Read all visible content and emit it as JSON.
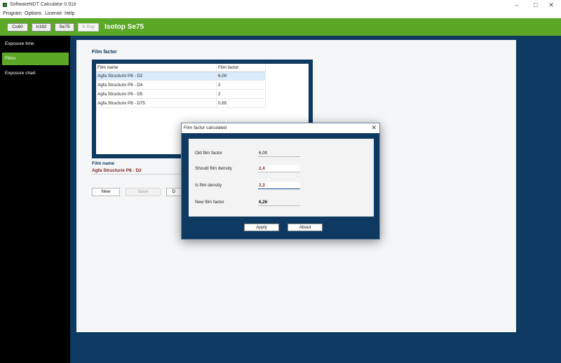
{
  "window": {
    "title": "SoftwareNDT Calculator 0.91e",
    "minimize_glyph": "–",
    "maximize_glyph": "□",
    "close_glyph": "✕"
  },
  "menu": [
    "Program",
    "Options",
    "License",
    "Help"
  ],
  "toolbar": {
    "isotopes": [
      {
        "label": "Co60",
        "enabled": true
      },
      {
        "label": "Ir192",
        "enabled": true
      },
      {
        "label": "Se75",
        "enabled": true
      },
      {
        "label": "X-Ray",
        "enabled": false
      }
    ],
    "current_title": "Isotop Se75"
  },
  "sidebar": {
    "items": [
      {
        "label": "Exposure time",
        "active": false
      },
      {
        "label": "Films",
        "active": true
      },
      {
        "label": "Exposure chart",
        "active": false
      }
    ]
  },
  "films": {
    "section_title": "Film factor",
    "columns": [
      "Film name",
      "Film factor"
    ],
    "rows": [
      {
        "name": "Agfa Structurix P8 - D2",
        "factor": "6,00"
      },
      {
        "name": "Agfa Structurix P8 - D4",
        "factor": "2"
      },
      {
        "name": "Agfa Structurix P8 - D5",
        "factor": "2"
      },
      {
        "name": "Agfa Structurix P8 - D75",
        "factor": "0,65"
      }
    ],
    "film_name_label": "Film name",
    "film_name_value": "Agfa Structurix P8 - D2",
    "buttons": {
      "new": "New",
      "save": "Save",
      "delete": "D"
    }
  },
  "dialog": {
    "title": "Film factor calculated",
    "close_glyph": "✕",
    "fields": {
      "old_label": "Old film factor",
      "old_value": "6,00",
      "should_label": "Should film density",
      "should_value": "2,4",
      "is_label": "Is film density",
      "is_value": "2,3",
      "new_label": "New film factor",
      "new_value": "6,26"
    },
    "apply_label": "Apply",
    "about_label": "About"
  },
  "colors": {
    "accent_green": "#5aa826",
    "navy": "#0e3960",
    "value_red": "#7a1f1f"
  }
}
